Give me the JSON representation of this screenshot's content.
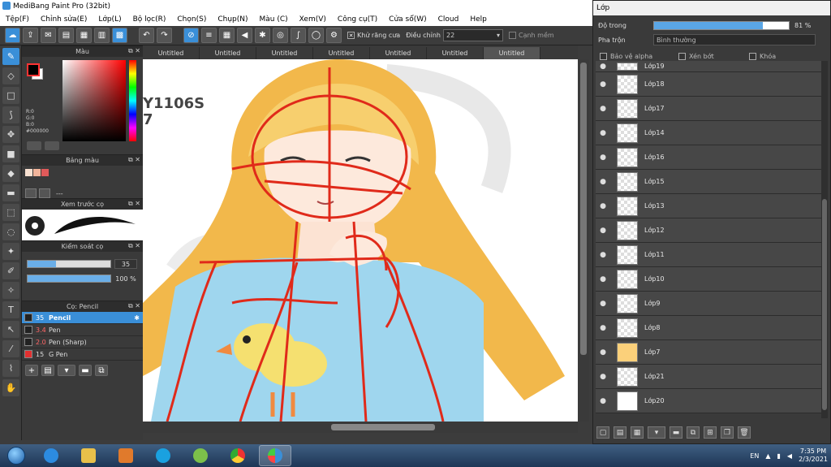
{
  "app": {
    "title": "MediBang Paint Pro (32bit)"
  },
  "menu": [
    "Tệp(F)",
    "Chỉnh sửa(E)",
    "Lớp(L)",
    "Bộ lọc(R)",
    "Chọn(S)",
    "Chụp(N)",
    "Màu (C)",
    "Xem(V)",
    "Công cụ(T)",
    "Cửa sổ(W)",
    "Cloud",
    "Help"
  ],
  "toolbar": {
    "antialias_label": "Khử răng cưa",
    "adjust_label": "Điều chỉnh",
    "adjust_value": "22",
    "edge_label": "Cạnh mềm"
  },
  "color_panel": {
    "title": "Màu",
    "r": "R:0",
    "g": "G:0",
    "b": "B:0",
    "hex": "#000000",
    "fg": "#000000",
    "bg": "#ffffff"
  },
  "palette_panel": {
    "title": "Bảng màu",
    "dash": "---"
  },
  "brush_preview": {
    "title": "Xem trước cọ"
  },
  "brush_control": {
    "title": "Kiểm soát cọ",
    "size": "35",
    "opacity": "100 %",
    "size_fraction": 0.34,
    "opacity_fraction": 1.0
  },
  "brush_list": {
    "title": "Cọ: Pencil",
    "items": [
      {
        "size": "35",
        "name": "Pencil",
        "color": "#222222"
      },
      {
        "size": "3.4",
        "name": "Pen",
        "color": "#222222"
      },
      {
        "size": "2.0",
        "name": "Pen (Sharp)",
        "color": "#222222"
      },
      {
        "size": "15",
        "name": "G Pen",
        "color": "#e23030"
      }
    ]
  },
  "tabs": [
    "Untitled",
    "Untitled",
    "Untitled",
    "Untitled",
    "Untitled",
    "Untitled",
    "Untitled"
  ],
  "canvas": {
    "watermark": "Y1106S\n7"
  },
  "layer_window": {
    "title": "Lớp",
    "opacity_label": "Độ trong",
    "opacity_value": "81 %",
    "opacity_fraction": 0.81,
    "blend_label": "Pha trộn",
    "blend_value": "Bình thường",
    "protect_alpha": "Bảo vệ alpha",
    "clipping": "Xén bớt",
    "lock": "Khóa",
    "layers": [
      "Lớp19",
      "Lớp18",
      "Lớp17",
      "Lớp14",
      "Lớp16",
      "Lớp15",
      "Lớp13",
      "Lớp12",
      "Lớp11",
      "Lớp10",
      "Lớp9",
      "Lớp8",
      "Lớp7",
      "Lớp21",
      "Lớp20"
    ]
  },
  "taskbar": {
    "lang": "EN",
    "time": "7:35 PM",
    "date": "2/3/2021"
  }
}
